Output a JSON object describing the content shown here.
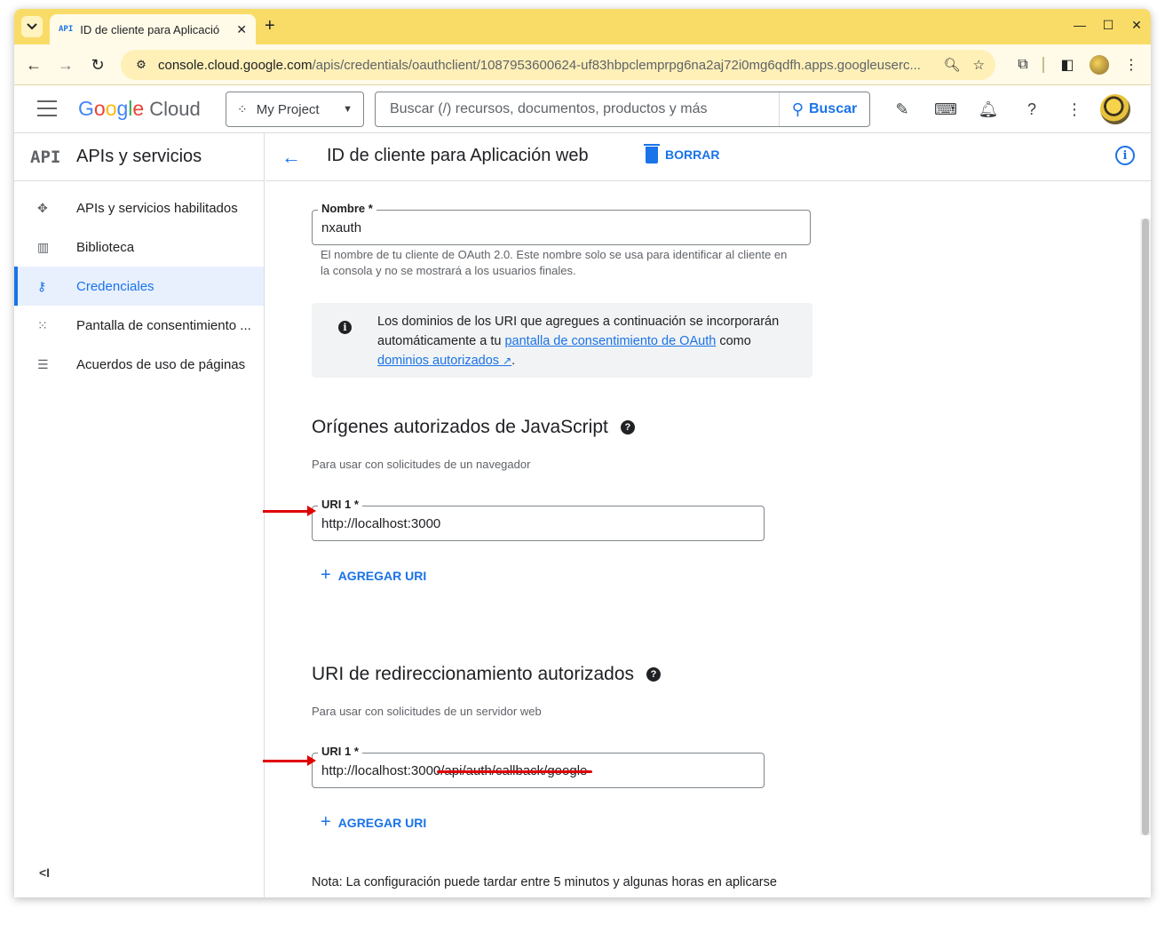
{
  "browser": {
    "tab_title": "ID de cliente para Aplicació",
    "tab_favicon": "API",
    "url_host": "console.cloud.google.com",
    "url_path": "/apis/credentials/oauthclient/1087953600624-uf83hbpclemprpg6na2aj72i0mg6qdfh.apps.googleuserc..."
  },
  "header": {
    "logo_google": "Google",
    "logo_cloud": "Cloud",
    "project": "My Project",
    "search_placeholder": "Buscar (/) recursos, documentos, productos y más",
    "search_button": "Buscar"
  },
  "sidebar": {
    "badge": "API",
    "title": "APIs y servicios",
    "items": [
      {
        "label": "APIs y servicios habilitados",
        "icon": "hub-icon"
      },
      {
        "label": "Biblioteca",
        "icon": "library-icon"
      },
      {
        "label": "Credenciales",
        "icon": "key-icon",
        "active": true
      },
      {
        "label": "Pantalla de consentimiento ...",
        "icon": "consent-icon"
      },
      {
        "label": "Acuerdos de uso de páginas",
        "icon": "settings-list-icon"
      }
    ],
    "collapse": "<I"
  },
  "main": {
    "page_title": "ID de cliente para Aplicación web",
    "delete_label": "BORRAR",
    "name_field": {
      "label": "Nombre *",
      "value": "nxauth",
      "hint_line1": "El nombre de tu cliente de OAuth 2.0. Este nombre solo se usa para identificar al cliente en",
      "hint_line2": "la consola y no se mostrará a los usuarios finales."
    },
    "info": {
      "text_1": "Los dominios de los URI que agregues a continuación se incorporarán automáticamente a tu ",
      "link_1": "pantalla de consentimiento de OAuth",
      "text_2": " como ",
      "link_2": "dominios autorizados",
      "link_2_icon": "↗",
      "text_3": "."
    },
    "js_origins": {
      "title": "Orígenes autorizados de JavaScript",
      "subtitle": "Para usar con solicitudes de un navegador",
      "uri_label": "URI 1 *",
      "uri_value": "http://localhost:3000",
      "add_label": "AGREGAR URI"
    },
    "redirect": {
      "title": "URI de redireccionamiento autorizados",
      "subtitle": "Para usar con solicitudes de un servidor web",
      "uri_label": "URI 1 *",
      "uri_value": "http://localhost:3000/api/auth/callback/google",
      "add_label": "AGREGAR URI"
    },
    "note": "Nota: La configuración puede tardar entre 5 minutos y algunas horas en aplicarse"
  },
  "colors": {
    "accent": "#1a73e8",
    "tab_strip": "#f9dc67",
    "annotation": "#e00000"
  }
}
